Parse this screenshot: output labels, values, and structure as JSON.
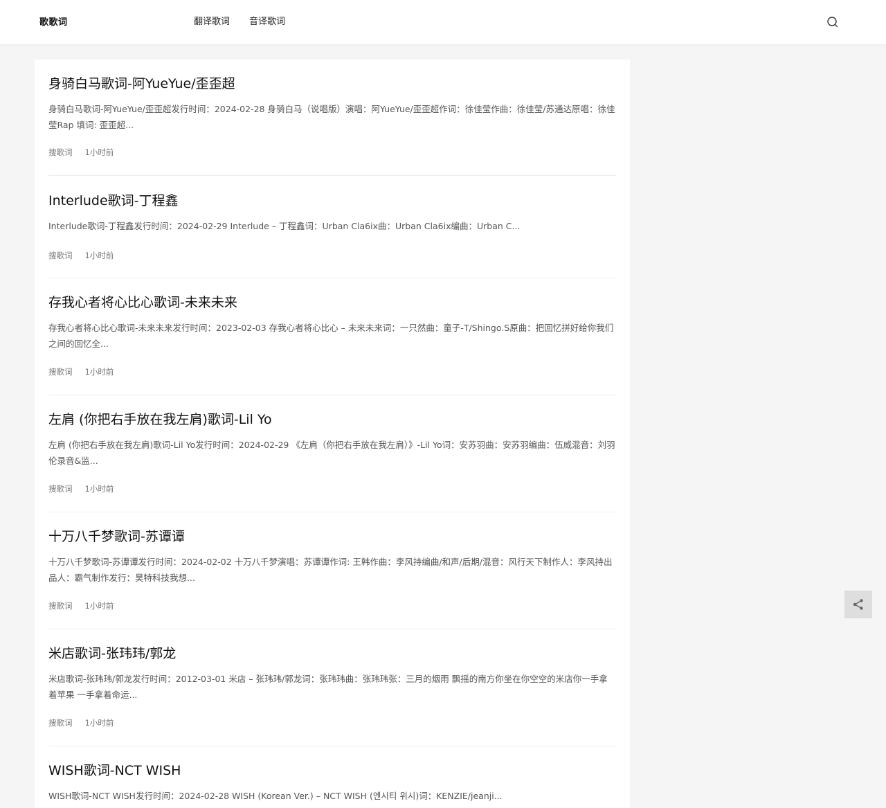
{
  "site": {
    "logo": "歌歌词"
  },
  "nav": {
    "items": [
      {
        "label": "翻译歌词"
      },
      {
        "label": "音译歌词"
      }
    ]
  },
  "icons": {
    "search": "search-icon",
    "share": "share-icon"
  },
  "posts": [
    {
      "title": "身骑白马歌词-阿YueYue/歪歪超",
      "excerpt": "身骑白马歌词-阿YueYue/歪歪超发行时间：2024-02-28 身骑白马（说唱版）演唱：阿YueYue/歪歪超作词：徐佳莹作曲：徐佳莹/苏通达原唱：徐佳莹Rap 填词: 歪歪超...",
      "category": "搜歌词",
      "time": "1小时前"
    },
    {
      "title": "Interlude歌词-丁程鑫",
      "excerpt": "Interlude歌词-丁程鑫发行时间：2024-02-29 Interlude – 丁程鑫词：Urban Cla6ix曲：Urban Cla6ix编曲：Urban C...",
      "category": "搜歌词",
      "time": "1小时前"
    },
    {
      "title": "存我心者将心比心歌词-未来未来",
      "excerpt": "存我心者将心比心歌词-未来未来发行时间：2023-02-03 存我心者将心比心 – 未来未来词：一只然曲：童子-T/Shingo.S原曲：把回忆拼好给你我们之间的回忆全...",
      "category": "搜歌词",
      "time": "1小时前"
    },
    {
      "title": "左肩 (你把右手放在我左肩)歌词-Lil Yo",
      "excerpt": "左肩 (你把右手放在我左肩)歌词-Lil Yo发行时间：2024-02-29 《左肩（你把右手放在我左肩）》-Lil Yo词：安苏羽曲：安苏羽编曲：伍威混音：刘羽伦录音&监...",
      "category": "搜歌词",
      "time": "1小时前"
    },
    {
      "title": "十万八千梦歌词-苏谭谭",
      "excerpt": "十万八千梦歌词-苏谭谭发行时间：2024-02-02 十万八千梦演唱：苏谭谭作词: 王韩作曲：李风持编曲/和声/后期/混音：风行天下制作人：李风持出品人：霸气制作发行：昊特科技我想...",
      "category": "搜歌词",
      "time": "1小时前"
    },
    {
      "title": "米店歌词-张玮玮/郭龙",
      "excerpt": "米店歌词-张玮玮/郭龙发行时间：2012-03-01 米店 – 张玮玮/郭龙词：张玮玮曲：张玮玮张：三月的烟雨 飘摇的南方你坐在你空空的米店你一手拿着苹果 一手拿着命运...",
      "category": "搜歌词",
      "time": "1小时前"
    },
    {
      "title": "WISH歌词-NCT WISH",
      "excerpt": "WISH歌词-NCT WISH发行时间：2024-02-28 WISH (Korean Ver.) – NCT WISH (엔시티 위시)词：KENZIE/jeanji...",
      "category": "搜歌词",
      "time": "1小时前"
    }
  ]
}
